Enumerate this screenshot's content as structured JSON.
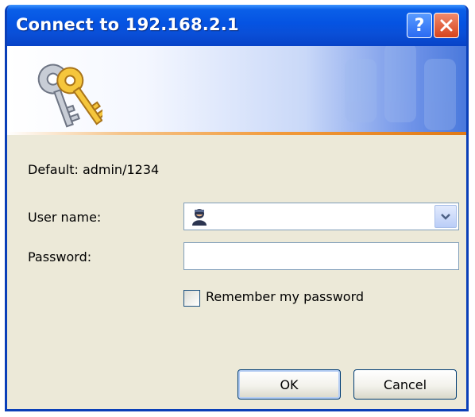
{
  "window": {
    "title": "Connect to 192.168.2.1",
    "help_label": "?",
    "title_color": "#0553e2"
  },
  "icons": {
    "banner": "keys-icon",
    "user": "user-icon",
    "dropdown": "chevron-down-icon",
    "help": "help-icon",
    "close": "close-icon"
  },
  "form": {
    "default_note": "Default: admin/1234",
    "user_label": "User name:",
    "user_value": "",
    "password_label": "Password:",
    "password_value": "",
    "remember_label": "Remember my password",
    "remember_checked": false
  },
  "buttons": {
    "ok": "OK",
    "cancel": "Cancel"
  }
}
